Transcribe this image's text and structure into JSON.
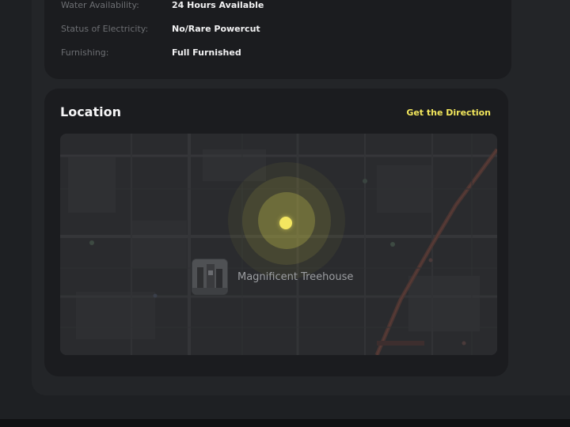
{
  "details": [
    {
      "label": "Water Availability:",
      "value": "24 Hours Available"
    },
    {
      "label": "Status of Electricity:",
      "value": "No/Rare Powercut"
    },
    {
      "label": "Furnishing:",
      "value": "Full Furnished"
    }
  ],
  "location": {
    "title": "Location",
    "direction_link": "Get the Direction",
    "place_name": "Magnificent Treehouse"
  },
  "colors": {
    "accent": "#f2e65c",
    "card": "#1b1c1f",
    "panel": "#232528",
    "background": "#1e2023"
  }
}
